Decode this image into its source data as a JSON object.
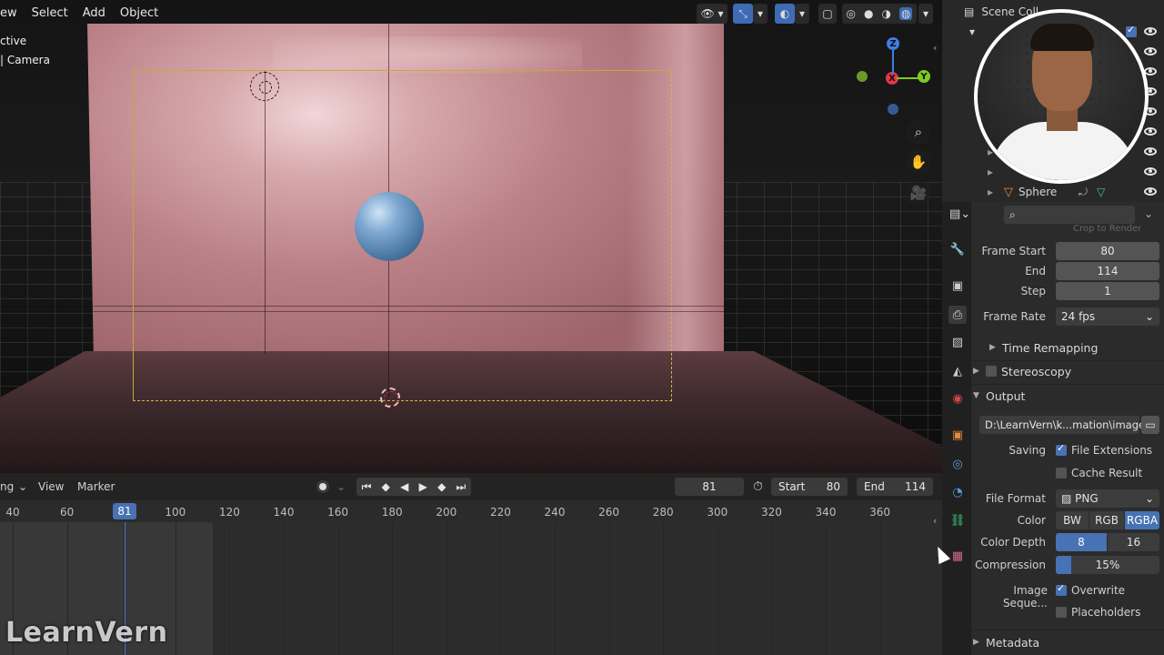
{
  "viewport": {
    "menu": [
      "ew",
      "Select",
      "Add",
      "Object"
    ],
    "overlay_line1": "ctive",
    "overlay_line2": "| Camera",
    "gizmo": {
      "z": "Z",
      "x": "X",
      "y": "Y"
    }
  },
  "timeline": {
    "editor_menu": "ng",
    "view": "View",
    "marker": "Marker",
    "current_frame": "81",
    "start_label": "Start",
    "start_value": "80",
    "end_label": "End",
    "end_value": "114",
    "ticks": [
      "40",
      "60",
      "81",
      "100",
      "120",
      "140",
      "160",
      "180",
      "200",
      "220",
      "240",
      "260",
      "280",
      "300",
      "320",
      "340",
      "360"
    ],
    "playhead": "81"
  },
  "watermark": "LearnVern",
  "outliner": {
    "title": "Scene Coll",
    "sphere": "Sphere"
  },
  "properties": {
    "search_placeholder": "",
    "hidden_row": "Crop to Render",
    "frame_start_label": "Frame Start",
    "frame_start": "80",
    "end_label": "End",
    "end": "114",
    "step_label": "Step",
    "step": "1",
    "frame_rate_label": "Frame Rate",
    "frame_rate": "24 fps",
    "time_remapping": "Time Remapping",
    "stereoscopy": "Stereoscopy",
    "output": "Output",
    "output_path": "D:\\LearnVern\\k...mation\\images\\",
    "saving_label": "Saving",
    "file_extensions": "File Extensions",
    "cache_result": "Cache Result",
    "file_format_label": "File Format",
    "file_format": "PNG",
    "color_label": "Color",
    "color_options": [
      "BW",
      "RGB",
      "RGBA"
    ],
    "color_depth_label": "Color Depth",
    "color_depth_options": [
      "8",
      "16"
    ],
    "compression_label": "Compression",
    "compression": "15%",
    "compression_fraction": 0.15,
    "image_sequence_label": "Image Seque...",
    "overwrite": "Overwrite",
    "placeholders": "Placeholders",
    "metadata": "Metadata"
  },
  "colors": {
    "accent": "#4772b3",
    "camera_frame": "#d9b544"
  }
}
